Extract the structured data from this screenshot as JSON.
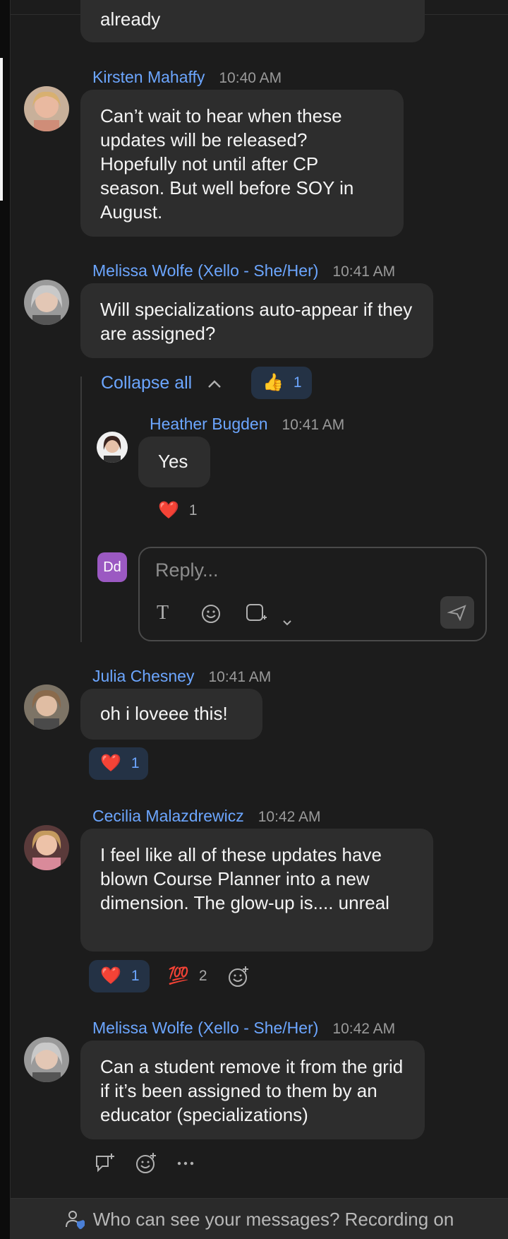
{
  "messages": [
    {
      "id": "m0",
      "text": "already"
    },
    {
      "id": "m1",
      "sender": "Kirsten Mahaffy",
      "time": "10:40 AM",
      "text": "Can’t wait to hear when these updates will be released? Hopefully not until after CP season. But well before SOY in August."
    },
    {
      "id": "m2",
      "sender": "Melissa Wolfe (Xello - She/Her)",
      "time": "10:41 AM",
      "text": "Will specializations auto-appear if they are assigned?",
      "collapse_label": "Collapse all",
      "reaction": {
        "emoji": "👍",
        "count": "1"
      },
      "reply": {
        "sender": "Heather Bugden",
        "time": "10:41 AM",
        "text": "Yes",
        "reaction": {
          "emoji": "❤️",
          "count": "1"
        }
      },
      "reply_box": {
        "avatar_initials": "Dd",
        "placeholder": "Reply...",
        "tools": [
          "text-format-icon",
          "emoji-icon",
          "screenshot-icon",
          "chevron-down-icon",
          "send-icon"
        ]
      }
    },
    {
      "id": "m3",
      "sender": "Julia Chesney",
      "time": "10:41 AM",
      "text": "oh i loveee this!",
      "reaction": {
        "emoji": "❤️",
        "count": "1"
      }
    },
    {
      "id": "m4",
      "sender": "Cecilia Malazdrewicz",
      "time": "10:42 AM",
      "text": "I feel like all of these updates have blown Course Planner into a new dimension. The glow-up is.... unreal",
      "reactions": [
        {
          "emoji": "❤️",
          "count": "1"
        },
        {
          "emoji": "💯",
          "count": "2"
        }
      ]
    },
    {
      "id": "m5",
      "sender": "Melissa Wolfe (Xello - She/Her)",
      "time": "10:42 AM",
      "text": "Can a student remove it from the grid if it’s been assigned to them by an educator (specializations)"
    }
  ],
  "footer": {
    "text": "Who can see your messages? Recording on"
  },
  "colors": {
    "background": "#1c1c1c",
    "bubble": "#2d2d2d",
    "sender": "#6ca6ff",
    "reaction_active": "#243245",
    "dd_avatar": "#9b59c2"
  }
}
